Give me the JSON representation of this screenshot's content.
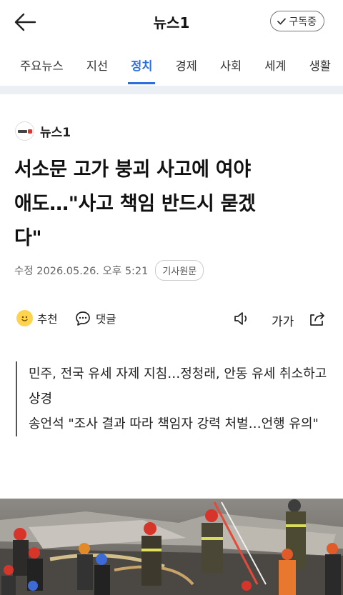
{
  "header": {
    "title": "뉴스1",
    "subscribe_label": "구독중"
  },
  "tabs": [
    {
      "label": "주요뉴스"
    },
    {
      "label": "지선"
    },
    {
      "label": "정치"
    },
    {
      "label": "경제"
    },
    {
      "label": "사회"
    },
    {
      "label": "세계"
    },
    {
      "label": "생활"
    }
  ],
  "active_tab": "정치",
  "article": {
    "press_name": "뉴스1",
    "press_logo_text": "뉴스1",
    "headline_lines": [
      "서소문 고가 붕괴 사고에 여야",
      "애도…\"사고 책임 반드시 묻겠",
      "다\""
    ],
    "date_text": "수정 2026.05.26. 오후 5:21",
    "original_label": "기사원문",
    "actions": {
      "recommend_label": "추천",
      "comment_label": "댓글",
      "font_label": "가가"
    },
    "summary": [
      "민주, 전국 유세 자제 지침…정청래, 안동 유세 취소하고 상경",
      "송언석 \"조사 결과 따라 책임자 강력 처벌…언행 유의\""
    ]
  },
  "colors": {
    "accent": "#2e6fe0",
    "band": "#eceff3",
    "text": "#111111"
  }
}
